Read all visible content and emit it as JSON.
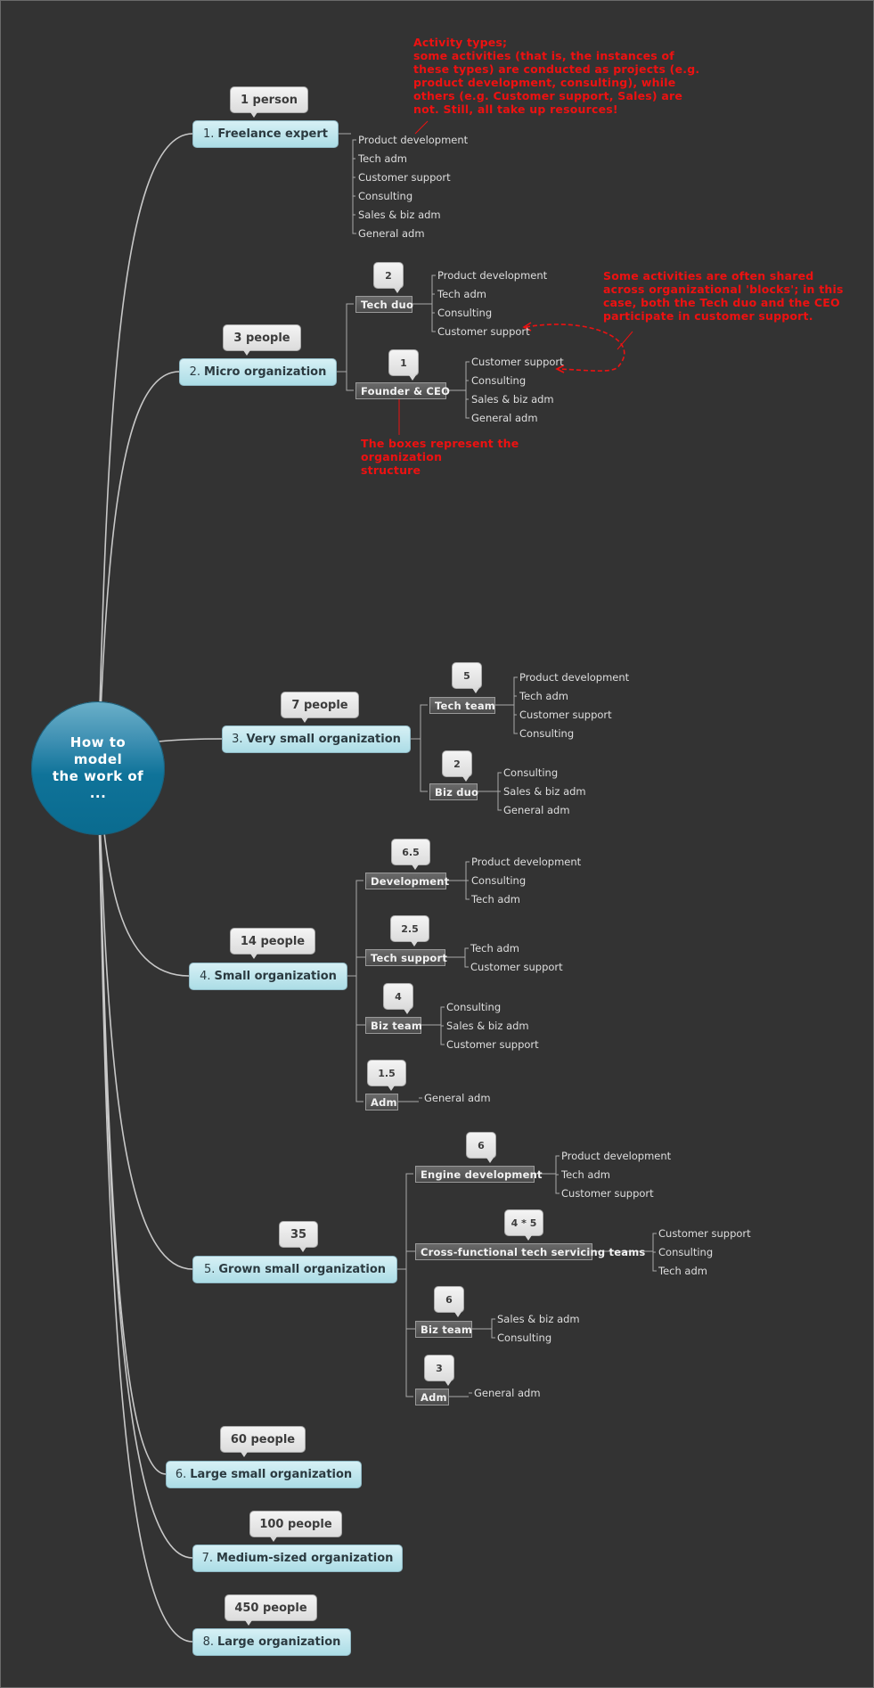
{
  "root": {
    "label": "How to\nmodel\nthe work of\n..."
  },
  "colors": {
    "background": "#333333",
    "root": "#0f7399",
    "org_node": "#acdde6",
    "note": "#ee1111"
  },
  "orgs": [
    {
      "num": "1.",
      "label": "Freelance expert",
      "size": "1 person",
      "activities": [
        "Product development",
        "Tech adm",
        "Customer support",
        "Consulting",
        "Sales & biz adm",
        "General adm"
      ],
      "teams": []
    },
    {
      "num": "2.",
      "label": "Micro organization",
      "size": "3 people",
      "teams": [
        {
          "label": "Tech duo",
          "headcount": "2",
          "activities": [
            "Product development",
            "Tech adm",
            "Consulting",
            "Customer support"
          ]
        },
        {
          "label": "Founder & CEO",
          "headcount": "1",
          "activities": [
            "Customer support",
            "Consulting",
            "Sales & biz adm",
            "General adm"
          ]
        }
      ]
    },
    {
      "num": "3.",
      "label": "Very small organization",
      "size": "7 people",
      "teams": [
        {
          "label": "Tech team",
          "headcount": "5",
          "activities": [
            "Product development",
            "Tech adm",
            "Customer support",
            "Consulting"
          ]
        },
        {
          "label": "Biz duo",
          "headcount": "2",
          "activities": [
            "Consulting",
            "Sales & biz adm",
            "General adm"
          ]
        }
      ]
    },
    {
      "num": "4.",
      "label": "Small organization",
      "size": "14 people",
      "teams": [
        {
          "label": "Development",
          "headcount": "6.5",
          "activities": [
            "Product development",
            "Consulting",
            "Tech adm"
          ]
        },
        {
          "label": "Tech support",
          "headcount": "2.5",
          "activities": [
            "Tech adm",
            "Customer support"
          ]
        },
        {
          "label": "Biz team",
          "headcount": "4",
          "activities": [
            "Consulting",
            "Sales & biz adm",
            "Customer support"
          ]
        },
        {
          "label": "Adm",
          "headcount": "1.5",
          "activities": [
            "General adm"
          ]
        }
      ]
    },
    {
      "num": "5.",
      "label": "Grown small organization",
      "size": "35",
      "teams": [
        {
          "label": "Engine development",
          "headcount": "6",
          "activities": [
            "Product development",
            "Tech adm",
            "Customer support"
          ]
        },
        {
          "label": "Cross-functional tech servicing teams",
          "headcount": "4 * 5",
          "activities": [
            "Customer support",
            "Consulting",
            "Tech adm"
          ]
        },
        {
          "label": "Biz team",
          "headcount": "6",
          "activities": [
            "Sales & biz adm",
            "Consulting"
          ]
        },
        {
          "label": "Adm",
          "headcount": "3",
          "activities": [
            "General adm"
          ]
        }
      ]
    },
    {
      "num": "6.",
      "label": "Large small organization",
      "size": "60 people",
      "teams": []
    },
    {
      "num": "7.",
      "label": "Medium-sized organization",
      "size": "100 people",
      "teams": []
    },
    {
      "num": "8.",
      "label": "Large organization",
      "size": "450 people",
      "teams": []
    }
  ],
  "notes": {
    "activity_types": "Activity types;\nsome activities (that is, the instances of\nthese types) are conducted as projects (e.g.\nproduct development, consulting), while\nothers (e.g. Customer support, Sales) are\nnot. Still, all take up resources!",
    "shared_activities": "Some activities are often shared\nacross organizational 'blocks'; in this\ncase, both the Tech duo and the CEO\nparticipate in customer support.",
    "boxes": "The boxes represent the\norganization\nstructure"
  }
}
